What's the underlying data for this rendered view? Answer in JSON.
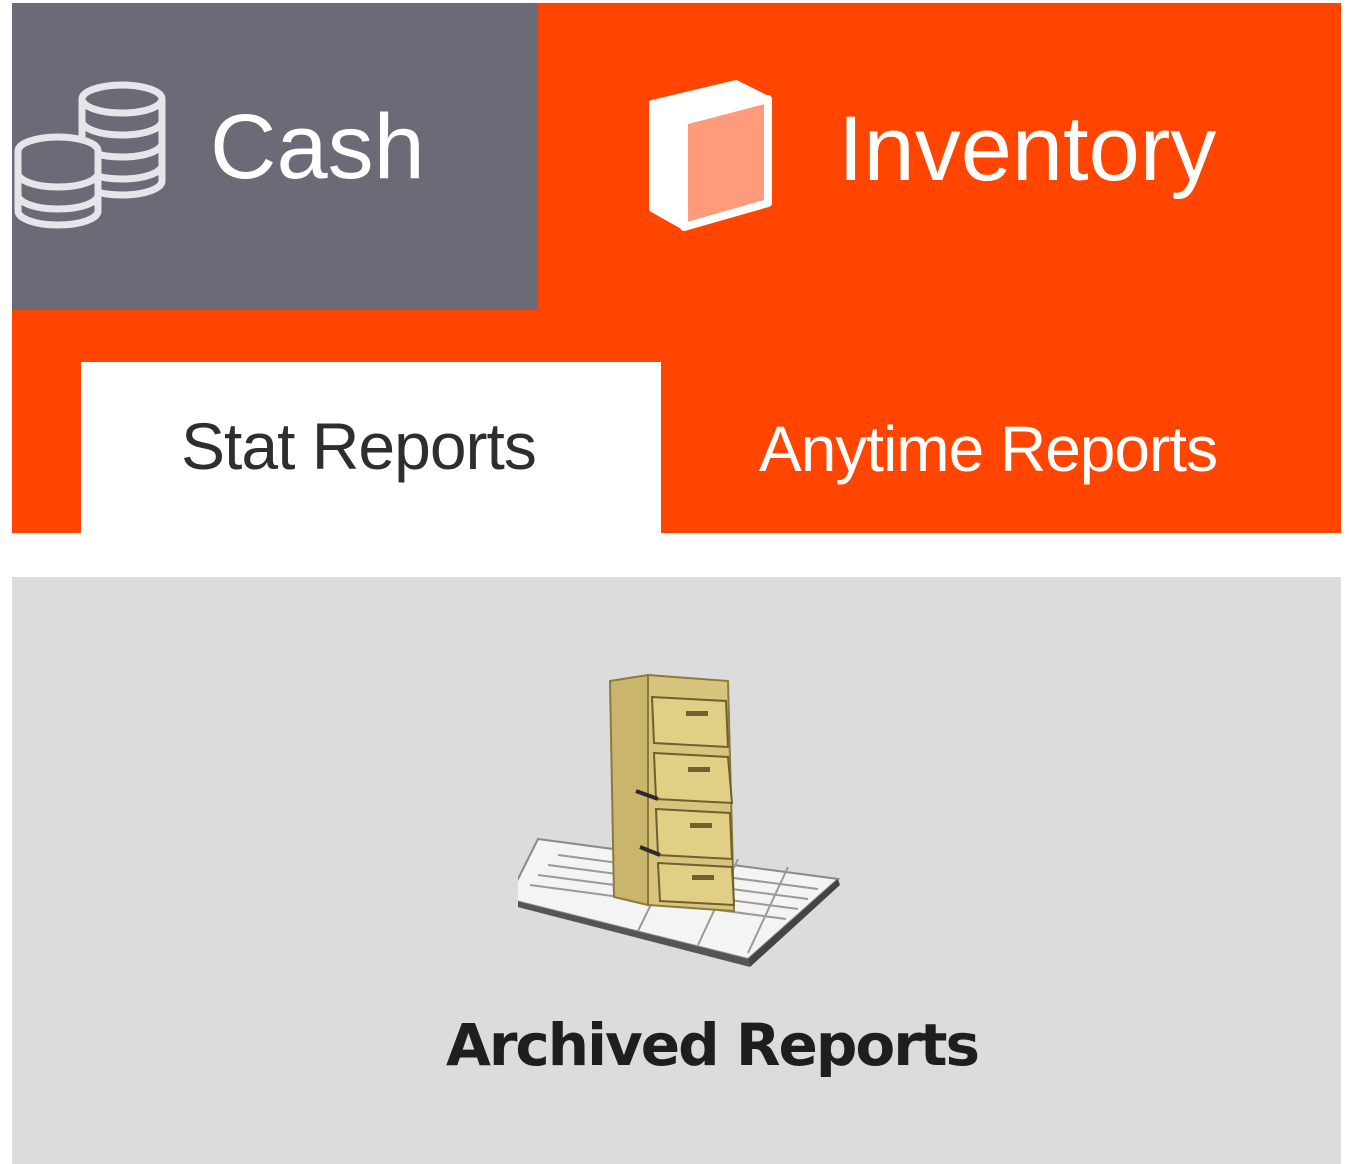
{
  "modules": {
    "cash": {
      "label": "Cash",
      "icon": "coins-icon"
    },
    "inventory": {
      "label": "Inventory",
      "icon": "box-icon"
    }
  },
  "subtabs": [
    {
      "label": "Stat Reports",
      "active": true
    },
    {
      "label": "Anytime Reports",
      "active": false
    }
  ],
  "content": {
    "tiles": [
      {
        "label": "Archived Reports",
        "icon": "filing-cabinet-icon"
      }
    ]
  },
  "colors": {
    "accent": "#ff4500",
    "module_inactive": "#6b6b78",
    "content_background": "#dcdcdc"
  }
}
